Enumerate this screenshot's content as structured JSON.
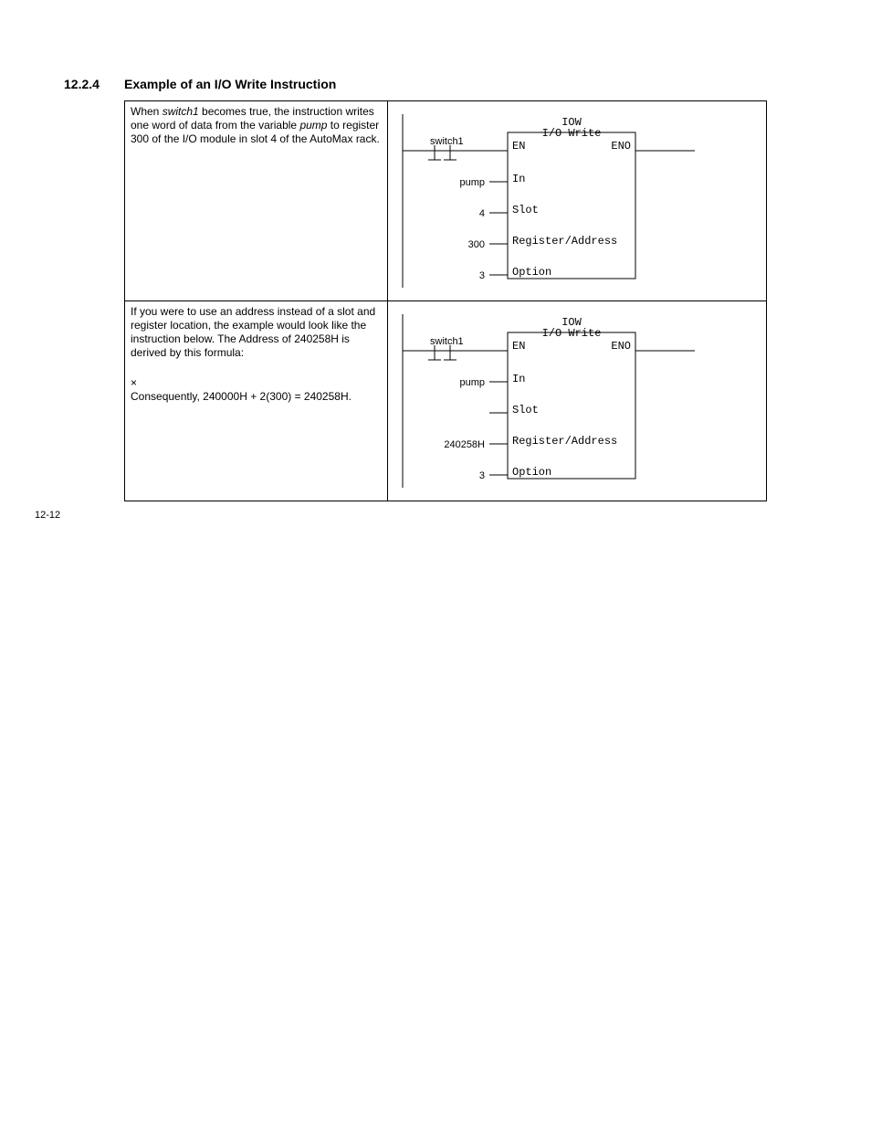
{
  "heading": {
    "number": "12.2.4",
    "title": "Example of an I/O Write Instruction"
  },
  "page_number": "12-12",
  "rows": [
    {
      "desc": {
        "p1a": "When ",
        "p1b": "switch1",
        "p1c": " becomes true, the instruction writes one word of data from the variable ",
        "p1d": "pump",
        "p1e": " to register 300 of the I/O module in slot 4 of the AutoMax rack."
      },
      "diagram": {
        "block_name": "IOW",
        "block_sub": "I/O Write",
        "en": "EN",
        "eno": "ENO",
        "contact": "switch1",
        "inputs": [
          {
            "val": "pump",
            "lbl": "In"
          },
          {
            "val": "4",
            "lbl": "Slot"
          },
          {
            "val": "300",
            "lbl": "Register/Address"
          },
          {
            "val": "3",
            "lbl": "Option"
          }
        ]
      }
    },
    {
      "desc": {
        "p1": "If you were to use an address instead of a slot and register location, the example would look like the instruction below. The Address of 240258H is derived by this formula:",
        "p2": "×",
        "p3": "Consequently, 240000H + 2(300) = 240258H."
      },
      "diagram": {
        "block_name": "IOW",
        "block_sub": "I/O Write",
        "en": "EN",
        "eno": "ENO",
        "contact": "switch1",
        "inputs": [
          {
            "val": "pump",
            "lbl": "In"
          },
          {
            "val": "",
            "lbl": "Slot"
          },
          {
            "val": "240258H",
            "lbl": "Register/Address"
          },
          {
            "val": "3",
            "lbl": "Option"
          }
        ]
      }
    }
  ]
}
